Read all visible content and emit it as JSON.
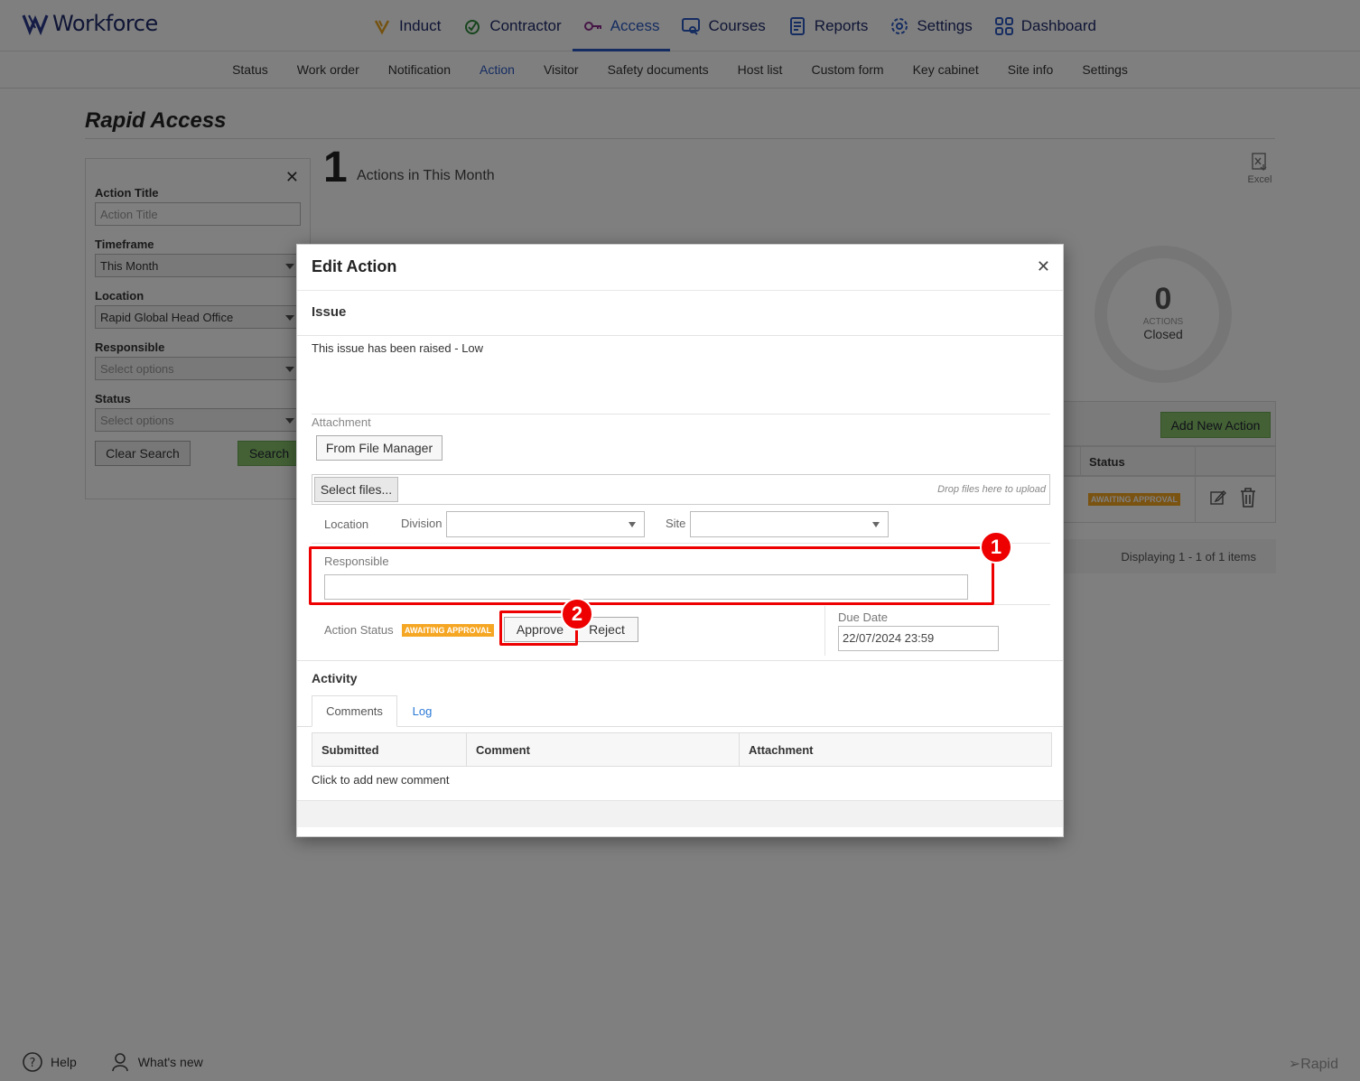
{
  "brand": {
    "name": "Workforce"
  },
  "mainnav": [
    {
      "label": "Induct",
      "icon": "induct-icon"
    },
    {
      "label": "Contractor",
      "icon": "contractor-icon"
    },
    {
      "label": "Access",
      "icon": "access-key-icon"
    },
    {
      "label": "Courses",
      "icon": "courses-icon"
    },
    {
      "label": "Reports",
      "icon": "reports-icon"
    },
    {
      "label": "Settings",
      "icon": "gear-icon"
    },
    {
      "label": "Dashboard",
      "icon": "dashboard-icon"
    }
  ],
  "subnav": [
    "Status",
    "Work order",
    "Notification",
    "Action",
    "Visitor",
    "Safety documents",
    "Host list",
    "Custom form",
    "Key cabinet",
    "Site info",
    "Settings"
  ],
  "page": {
    "title": "Rapid Access"
  },
  "filter": {
    "action_title_label": "Action Title",
    "action_title_placeholder": "Action Title",
    "timeframe_label": "Timeframe",
    "timeframe_value": "This Month",
    "location_label": "Location",
    "location_value": "Rapid Global Head Office",
    "responsible_label": "Responsible",
    "responsible_placeholder": "Select options",
    "status_label": "Status",
    "status_placeholder": "Select options",
    "clear_label": "Clear Search",
    "search_label": "Search"
  },
  "summary": {
    "count": "1",
    "label": "Actions in This Month",
    "excel_label": "Excel"
  },
  "donut": {
    "value": "0",
    "unit": "ACTIONS",
    "label": "Closed"
  },
  "grid": {
    "add_label": "Add New Action",
    "status_header": "Status",
    "row_status": "AWAITING APPROVAL",
    "footer": "Displaying 1 - 1 of 1 items"
  },
  "modal": {
    "title": "Edit Action",
    "issue_title": "Issue",
    "issue_text": "This issue has been raised - Low",
    "attachment_label": "Attachment",
    "file_manager_label": "From File Manager",
    "select_files_label": "Select files...",
    "drop_hint": "Drop files here to upload",
    "location_label": "Location",
    "division_label": "Division",
    "site_label": "Site",
    "responsible_label": "Responsible",
    "action_status_label": "Action Status",
    "action_status_badge": "AWAITING APPROVAL",
    "approve_label": "Approve",
    "reject_label": "Reject",
    "due_date_label": "Due Date",
    "due_date_value": "22/07/2024 23:59",
    "activity_title": "Activity",
    "tabs": [
      "Comments",
      "Log"
    ],
    "table_headers": [
      "Submitted",
      "Comment",
      "Attachment"
    ],
    "add_comment": "Click to add new comment"
  },
  "markers": [
    "1",
    "2"
  ],
  "footer": {
    "help": "Help",
    "whats_new": "What's new",
    "rapid": "Rapid"
  }
}
